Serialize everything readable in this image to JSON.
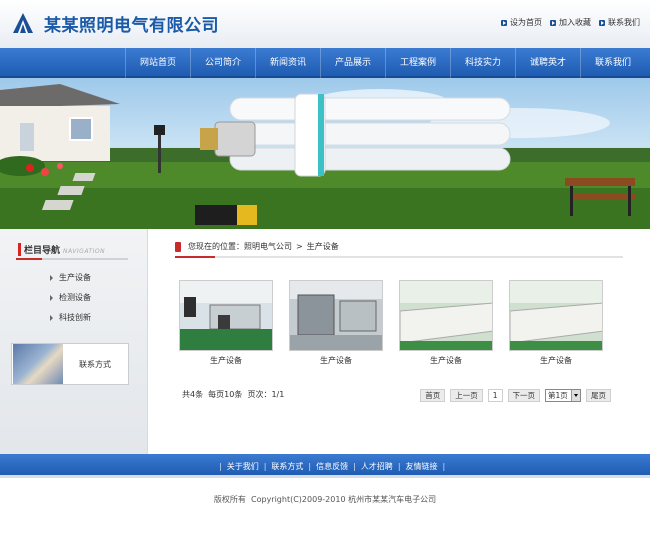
{
  "header": {
    "title": "某某照明电气有限公司",
    "links": [
      "设为首页",
      "加入收藏",
      "联系我们"
    ]
  },
  "nav": [
    "网站首页",
    "公司简介",
    "新闻资讯",
    "产品展示",
    "工程案例",
    "科技实力",
    "诚聘英才",
    "联系我们"
  ],
  "sidebar": {
    "title": "栏目导航",
    "subtitle": "NAVIGATION",
    "items": [
      "生产设备",
      "检测设备",
      "科技创新"
    ],
    "contact_label": "联系方式"
  },
  "main": {
    "breadcrumb_prefix": "您现在的位置：",
    "breadcrumb_home": "照明电气公司",
    "breadcrumb_sep": ">",
    "breadcrumb_current": "生产设备",
    "products": [
      {
        "name": "生产设备"
      },
      {
        "name": "生产设备"
      },
      {
        "name": "生产设备"
      },
      {
        "name": "生产设备"
      }
    ],
    "pager_info": "共4条  每页10条  页次：1/1",
    "pager": {
      "first": "首页",
      "prev": "上一页",
      "current": "1",
      "next": "下一页",
      "select_value": "第1页",
      "last": "尾页"
    }
  },
  "footer": {
    "links": [
      "关于我们",
      "联系方式",
      "信息反馈",
      "人才招聘",
      "友情链接"
    ],
    "copyright": "版权所有  Copyright(C)2009-2010 杭州市某某汽车电子公司"
  },
  "colors": {
    "brand_blue": "#1a5aa8",
    "nav_blue": "#2b6cc4",
    "accent_red": "#c92a2a"
  }
}
